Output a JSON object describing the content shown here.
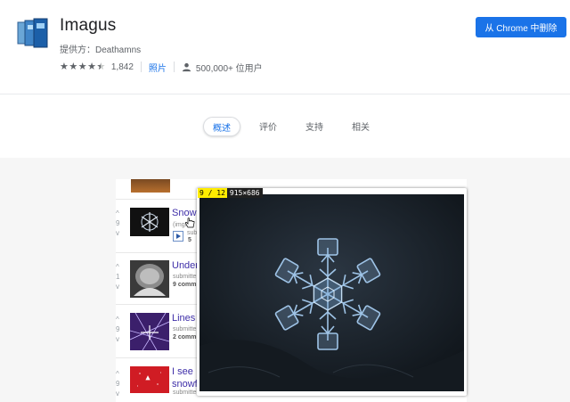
{
  "extension": {
    "name": "Imagus",
    "provider": "提供方：Deathamns",
    "rating": 4.5,
    "rating_count": "1,842",
    "photos_link": "照片",
    "users": "500,000+ 位用户",
    "remove_button": "从 Chrome 中删除"
  },
  "tabs": [
    {
      "label": "概述",
      "active": true
    },
    {
      "label": "评价",
      "active": false
    },
    {
      "label": "支持",
      "active": false
    },
    {
      "label": "相关",
      "active": false
    }
  ],
  "screenshot": {
    "posts": [
      {
        "title": "Snow",
        "subtitle": "(imgur.",
        "submitted": "submitte",
        "comments": "5",
        "vote": "9"
      },
      {
        "title": "Under",
        "subtitle": "submitte",
        "comments": "9 comm",
        "vote": "1"
      },
      {
        "title": "Lines",
        "subtitle": "submitte",
        "comments": "2 comm",
        "vote": "9"
      },
      {
        "title": "I see",
        "title2": "snowf",
        "subtitle": "submitte",
        "vote": "9"
      }
    ],
    "popup": {
      "counter": "9 / 12",
      "dimensions": "915×686"
    }
  },
  "colors": {
    "accent": "#1a73e8",
    "counter_bg": "#ffec00",
    "link_purple": "#3e2ea8"
  },
  "icons": [
    "imagus-logo-icon",
    "star-icon",
    "users-icon",
    "play-icon",
    "hand-cursor-icon"
  ]
}
